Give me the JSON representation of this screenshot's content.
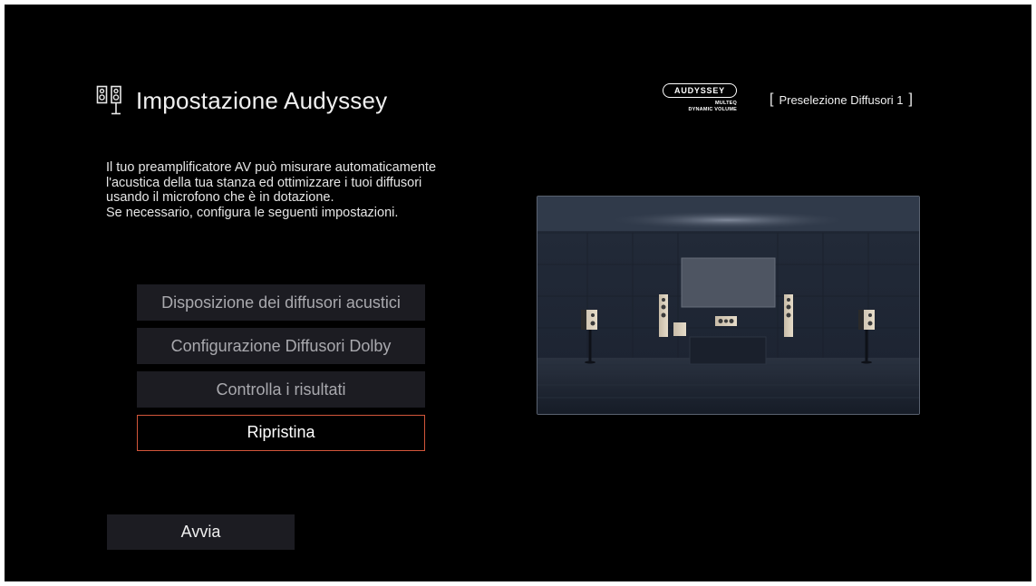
{
  "header": {
    "title": "Impostazione Audyssey",
    "title_icon": "speakers-icon",
    "logo": {
      "brand": "AUDYSSEY",
      "line1": "MULTEQ",
      "line2": "DYNAMIC VOLUME"
    },
    "preset": {
      "open_bracket": "[",
      "label": "Preselezione Diffusori 1",
      "close_bracket": "]"
    }
  },
  "description": {
    "lines": [
      "Il tuo preamplificatore AV può misurare automaticamente",
      "l'acustica della tua stanza ed ottimizzare i tuoi diffusori",
      "usando il microfono che è in dotazione.",
      "Se necessario, configura le seguenti impostazioni."
    ]
  },
  "menu": {
    "items": [
      {
        "label": "Disposizione dei diffusori acustici",
        "selected": false
      },
      {
        "label": "Configurazione Diffusori Dolby",
        "selected": false
      },
      {
        "label": "Controlla i risultati",
        "selected": false
      },
      {
        "label": "Ripristina",
        "selected": true
      }
    ]
  },
  "start_button": {
    "label": "Avvia"
  },
  "illustration": {
    "name": "home-theater-room-illustration"
  },
  "colors": {
    "background": "#000000",
    "menu_item_bg": "#1c1c22",
    "menu_item_text": "#a9a9ae",
    "selection_border": "#d2563a",
    "text": "#f0f0f0"
  }
}
